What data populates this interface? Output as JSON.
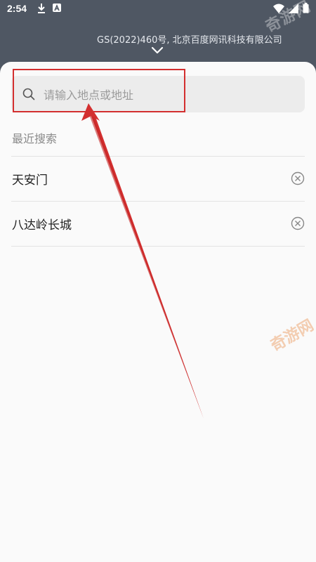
{
  "status_bar": {
    "time": "2:54",
    "left_icons": [
      "download-icon",
      "accessibility-a-icon"
    ],
    "right_icons": [
      "wifi-icon",
      "signal-icon",
      "battery-icon"
    ]
  },
  "copyright": "GS(2022)460号, 北京百度网讯科技有限公司",
  "watermark": "奇游网",
  "search": {
    "placeholder": "请输入地点或地址",
    "value": ""
  },
  "recent": {
    "title": "最近搜索",
    "items": [
      {
        "label": "天安门"
      },
      {
        "label": "八达岭长城"
      }
    ]
  },
  "colors": {
    "header_bg": "#4f5763",
    "sheet_bg": "#fafafa",
    "annotation_red": "#d32f2f"
  }
}
